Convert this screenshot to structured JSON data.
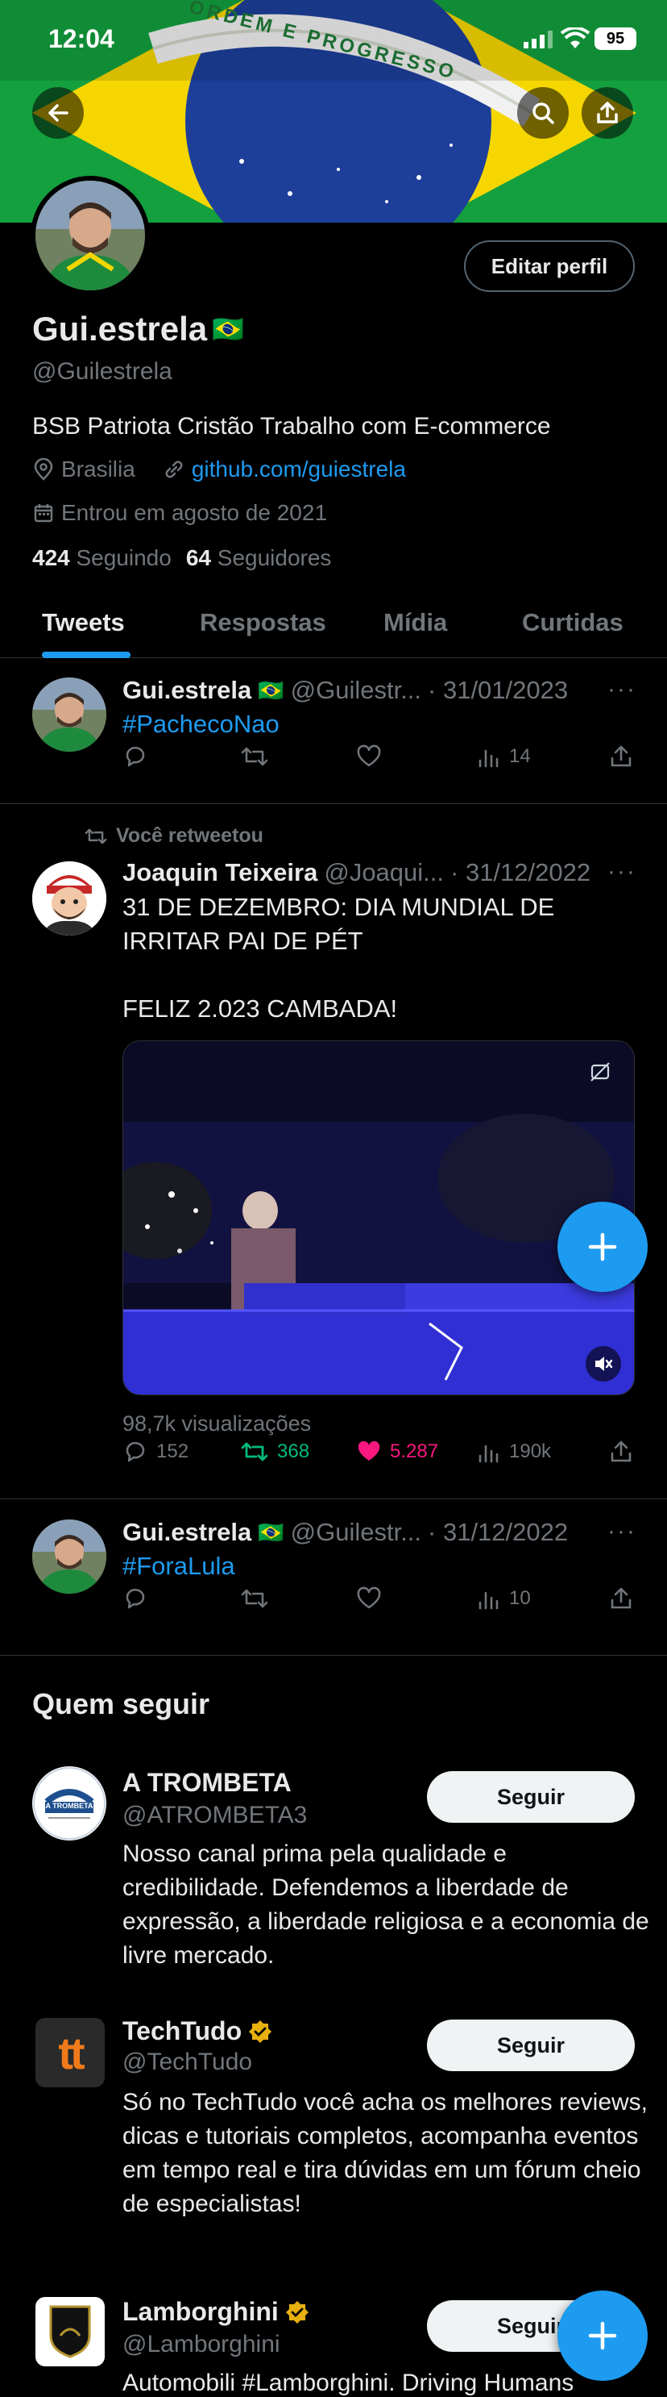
{
  "status": {
    "time": "12:04",
    "battery": "95"
  },
  "banner": {
    "motto": "ORDEM E PROGRESSO"
  },
  "profile": {
    "name": "Gui.estrela",
    "flag": "🇧🇷",
    "handle": "@Guilestrela",
    "edit_label": "Editar perfil",
    "bio": "BSB Patriota Cristão Trabalho com E-commerce",
    "location": "Brasilia",
    "website": "github.com/guiestrela",
    "joined": "Entrou em agosto de 2021",
    "following_count": "424",
    "following_label": "Seguindo",
    "followers_count": "64",
    "followers_label": "Seguidores"
  },
  "tabs": [
    {
      "label": "Tweets",
      "active": true
    },
    {
      "label": "Respostas"
    },
    {
      "label": "Mídia"
    },
    {
      "label": "Curtidas"
    }
  ],
  "tweets": [
    {
      "name": "Gui.estrela",
      "flag": "🇧🇷",
      "handle": "@Guilestr...",
      "date": "· 31/01/2023",
      "text": "#PachecoNao",
      "replies": "",
      "retweets": "",
      "likes": "",
      "views": "14"
    },
    {
      "retweet_label": "Você retweetou",
      "name": "Joaquin Teixeira",
      "handle": "@Joaqui...",
      "date": "· 31/12/2022",
      "text_line1": "31 DE DEZEMBRO: DIA MUNDIAL DE",
      "text_line2": "IRRITAR PAI DE PÉT",
      "text_line3": "FELIZ 2.023 CAMBADA!",
      "views_text": "98,7k visualizações",
      "replies": "152",
      "retweets": "368",
      "likes": "5.287",
      "views": "190k"
    },
    {
      "name": "Gui.estrela",
      "flag": "🇧🇷",
      "handle": "@Guilestr...",
      "date": "· 31/12/2022",
      "text": "#ForaLula",
      "views": "10"
    }
  ],
  "who_to_follow": {
    "title": "Quem seguir",
    "follow_label": "Seguir",
    "accounts": [
      {
        "name": "A TROMBETA",
        "handle": "@ATROMBETA3",
        "bio": "Nosso canal prima pela qualidade e credibilidade. Defendemos a liberdade de expressão, a liberdade religiosa e a economia de livre mercado.",
        "logo_text": "A TROMBETA"
      },
      {
        "name": "TechTudo",
        "handle": "@TechTudo",
        "bio": "Só no TechTudo você acha os melhores reviews, dicas e tutoriais completos, acompanha eventos em tempo real e tira dúvidas em um fórum cheio de especialistas!",
        "logo_text": "tt"
      },
      {
        "name": "Lamborghini",
        "handle": "@Lamborghini",
        "bio": "Automobili #Lamborghini. Driving Humans"
      }
    ]
  },
  "colors": {
    "accent": "#1d9bf0",
    "like": "#f91880",
    "retweet": "#00ba7c",
    "verified": "#ffd400"
  }
}
